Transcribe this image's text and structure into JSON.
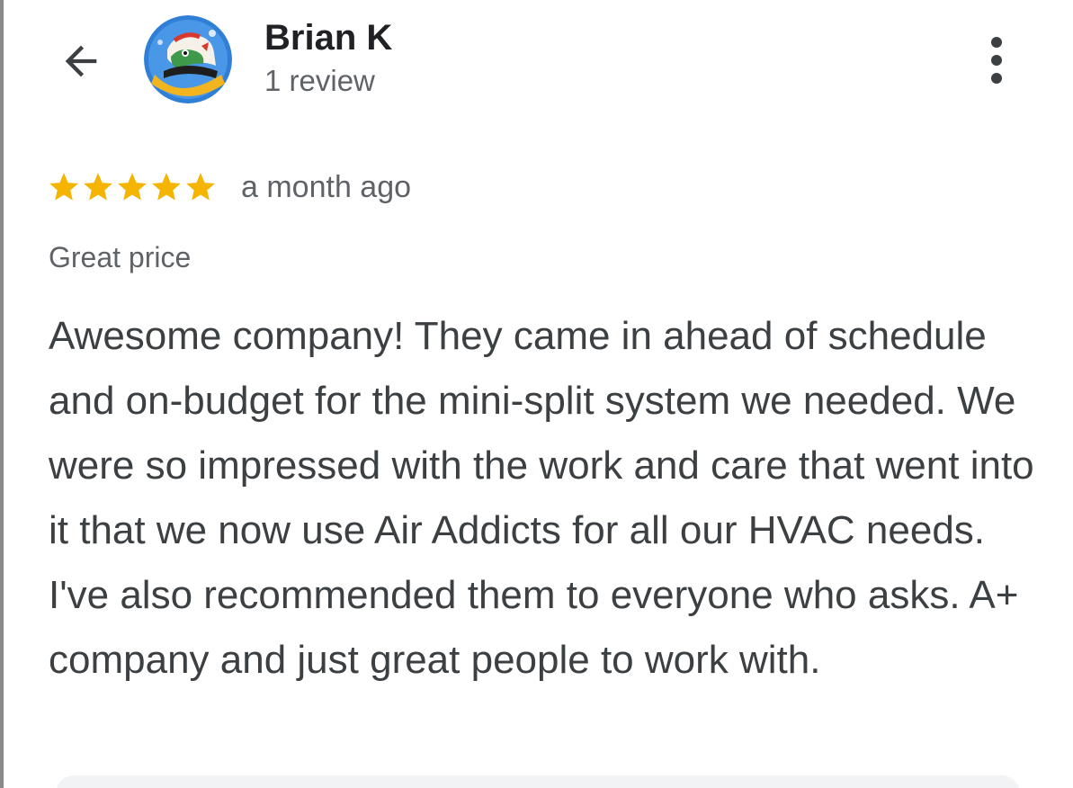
{
  "header": {
    "back_icon": "arrow-back-icon",
    "avatar_icon": "user-avatar-illustration",
    "user_name": "Brian K",
    "review_count": "1 review",
    "more_icon": "more-vertical-icon"
  },
  "review": {
    "rating": 5,
    "rating_max": 5,
    "star_color": "#F4B400",
    "time_ago": "a month ago",
    "highlight": "Great price",
    "text": "Awesome company! They came in ahead of schedule and on-budget for the mini-split system we needed. We were so impressed with the work and care that went into it that we now use Air Addicts for all our HVAC needs. I've also recommended them to everyone who asks. A+ company and just great people to work with."
  },
  "colors": {
    "title": "#202124",
    "secondary": "#5f6368",
    "body": "#3c4043"
  }
}
